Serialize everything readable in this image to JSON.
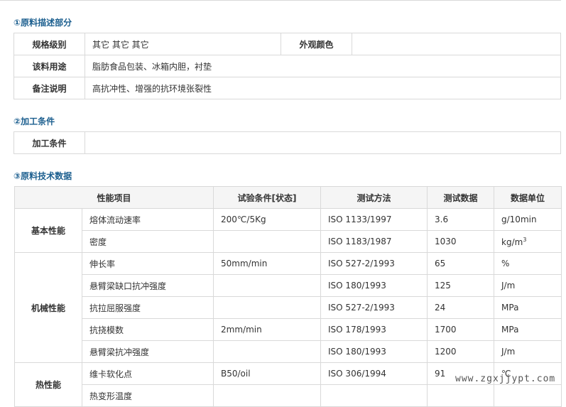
{
  "sections": {
    "desc_title": "①原料描述部分",
    "proc_title": "②加工条件",
    "tech_title": "③原料技术数据"
  },
  "desc": {
    "grade_label": "规格级别",
    "grade_value": "其它 其它 其它",
    "color_label": "外观颜色",
    "color_value": "",
    "use_label": "该料用途",
    "use_value": "脂肪食品包装、冰箱内胆，衬垫",
    "note_label": "备注说明",
    "note_value": "高抗冲性、增强的抗环境张裂性"
  },
  "proc": {
    "label": "加工条件",
    "value": ""
  },
  "tech": {
    "headers": [
      "性能项目",
      "试验条件[状态]",
      "测试方法",
      "测试数据",
      "数据单位"
    ],
    "groups": {
      "basic": "基本性能",
      "mech": "机械性能",
      "thermal": "热性能"
    },
    "rows": [
      {
        "item": "熔体流动速率",
        "cond": "200℃/5Kg",
        "method": "ISO 1133/1997",
        "value": "3.6",
        "unit": "g/10min"
      },
      {
        "item": "密度",
        "cond": "",
        "method": "ISO 1183/1987",
        "value": "1030",
        "unit": "kg/m",
        "unit_sup": "3"
      },
      {
        "item": "伸长率",
        "cond": "50mm/min",
        "method": "ISO 527-2/1993",
        "value": "65",
        "unit": "%"
      },
      {
        "item": "悬臂梁缺口抗冲强度",
        "cond": "",
        "method": "ISO 180/1993",
        "value": "125",
        "unit": "J/m"
      },
      {
        "item": "抗拉屈服强度",
        "cond": "",
        "method": "ISO 527-2/1993",
        "value": "24",
        "unit": "MPa"
      },
      {
        "item": "抗挠模数",
        "cond": "2mm/min",
        "method": "ISO 178/1993",
        "value": "1700",
        "unit": "MPa"
      },
      {
        "item": "悬臂梁抗冲强度",
        "cond": "",
        "method": "ISO 180/1993",
        "value": "1200",
        "unit": "J/m"
      },
      {
        "item": "维卡软化点",
        "cond": "B50/oil",
        "method": "ISO 306/1994",
        "value": "91",
        "unit": "℃"
      },
      {
        "item": "热变形温度",
        "cond": "",
        "method": "",
        "value": "",
        "unit": ""
      }
    ]
  },
  "watermark": "www.zgxjjypt.com"
}
